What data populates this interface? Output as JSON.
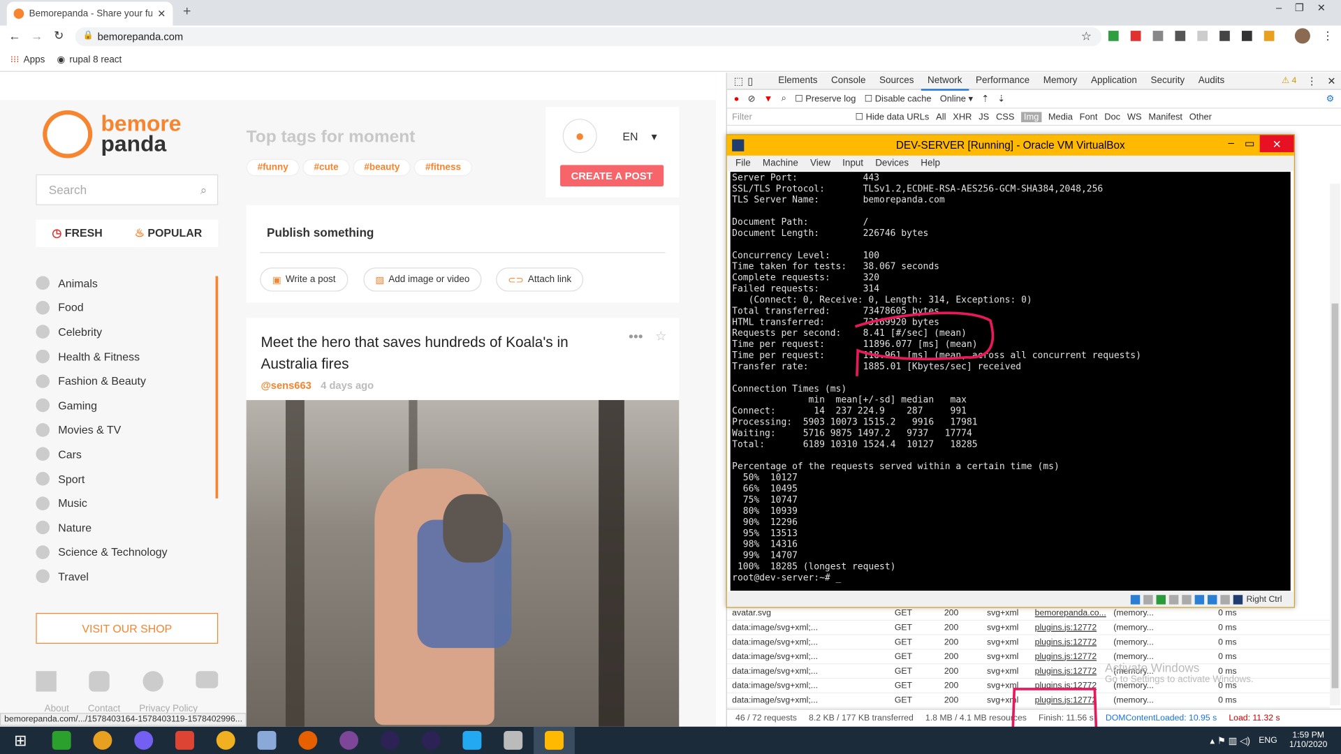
{
  "browser": {
    "tab_title": "Bemorepanda - Share your funny",
    "url": "bemorepanda.com",
    "bookmarks": [
      "Apps",
      "rupal 8 react"
    ],
    "status_url": "bemorepanda.com/.../1578403164-1578403119-1578402996..."
  },
  "site": {
    "logo_line1": "bemore",
    "logo_line2": "panda",
    "search_placeholder": "Search",
    "fresh": "FRESH",
    "popular": "POPULAR",
    "categories": [
      "Animals",
      "Food",
      "Celebrity",
      "Health & Fitness",
      "Fashion & Beauty",
      "Gaming",
      "Movies & TV",
      "Cars",
      "Sport",
      "Music",
      "Nature",
      "Science & Technology",
      "Travel"
    ],
    "visit_shop": "VISIT OUR SHOP",
    "footer_links": [
      "About",
      "Contact",
      "Privacy Policy"
    ],
    "top_tags_title": "Top tags for moment",
    "tags": [
      "#funny",
      "#cute",
      "#beauty",
      "#fitness"
    ],
    "lang": "EN",
    "create_post": "CREATE A POST",
    "publish": "Publish something",
    "actions": [
      "Write a post",
      "Add image or video",
      "Attach link"
    ],
    "post_title": "Meet the hero that saves hundreds of Koala's in Australia fires",
    "post_author": "@sens663",
    "post_time": "4 days ago"
  },
  "devtools": {
    "tabs": [
      "Elements",
      "Console",
      "Sources",
      "Network",
      "Performance",
      "Memory",
      "Application",
      "Security",
      "Audits"
    ],
    "active_tab": "Network",
    "warnings": "4",
    "preserve_log": "Preserve log",
    "disable_cache": "Disable cache",
    "online": "Online",
    "filter_placeholder": "Filter",
    "hide_data_urls": "Hide data URLs",
    "filter_types": [
      "All",
      "XHR",
      "JS",
      "CSS",
      "Img",
      "Media",
      "Font",
      "Doc",
      "WS",
      "Manifest",
      "Other"
    ],
    "active_filter": "Img",
    "rows": [
      {
        "name": "avatar.svg",
        "method": "GET",
        "status": "200",
        "type": "svg+xml",
        "initiator": "bemorepanda.co...",
        "size": "(memory...",
        "time": "0 ms"
      },
      {
        "name": "data:image/svg+xml;...",
        "method": "GET",
        "status": "200",
        "type": "svg+xml",
        "initiator": "plugins.js:12772",
        "size": "(memory...",
        "time": "0 ms"
      },
      {
        "name": "data:image/svg+xml;...",
        "method": "GET",
        "status": "200",
        "type": "svg+xml",
        "initiator": "plugins.js:12772",
        "size": "(memory...",
        "time": "0 ms"
      },
      {
        "name": "data:image/svg+xml;...",
        "method": "GET",
        "status": "200",
        "type": "svg+xml",
        "initiator": "plugins.js:12772",
        "size": "(memory...",
        "time": "0 ms"
      },
      {
        "name": "data:image/svg+xml;...",
        "method": "GET",
        "status": "200",
        "type": "svg+xml",
        "initiator": "plugins.js:12772",
        "size": "(memory...",
        "time": "0 ms"
      },
      {
        "name": "data:image/svg+xml;...",
        "method": "GET",
        "status": "200",
        "type": "svg+xml",
        "initiator": "plugins.js:12772",
        "size": "(memory...",
        "time": "0 ms"
      },
      {
        "name": "data:image/svg+xml;...",
        "method": "GET",
        "status": "200",
        "type": "svg+xml",
        "initiator": "plugins.js:12772",
        "size": "(memory...",
        "time": "0 ms"
      }
    ],
    "status_bar": [
      "46 / 72 requests",
      "8.2 KB / 177 KB transferred",
      "1.8 MB / 4.1 MB resources",
      "Finish: 11.56 s",
      "DOMContentLoaded: 10.95 s",
      "Load: 11.32 s"
    ],
    "watermark1": "Activate Windows",
    "watermark2": "Go to Settings to activate Windows."
  },
  "vm": {
    "title": "DEV-SERVER [Running] - Oracle VM VirtualBox",
    "menu": [
      "File",
      "Machine",
      "View",
      "Input",
      "Devices",
      "Help"
    ],
    "host_key": "Right Ctrl",
    "terminal": [
      "Server Port:            443",
      "SSL/TLS Protocol:       TLSv1.2,ECDHE-RSA-AES256-GCM-SHA384,2048,256",
      "TLS Server Name:        bemorepanda.com",
      "",
      "Document Path:          /",
      "Document Length:        226746 bytes",
      "",
      "Concurrency Level:      100",
      "Time taken for tests:   38.067 seconds",
      "Complete requests:      320",
      "Failed requests:        314",
      "   (Connect: 0, Receive: 0, Length: 314, Exceptions: 0)",
      "Total transferred:      73478605 bytes",
      "HTML transferred:       73169920 bytes",
      "Requests per second:    8.41 [#/sec] (mean)",
      "Time per request:       11896.077 [ms] (mean)",
      "Time per request:       118.961 [ms] (mean, across all concurrent requests)",
      "Transfer rate:          1885.01 [Kbytes/sec] received",
      "",
      "Connection Times (ms)",
      "              min  mean[+/-sd] median   max",
      "Connect:       14  237 224.9    287     991",
      "Processing:  5903 10073 1515.2   9916   17981",
      "Waiting:     5716 9875 1497.2   9737   17774",
      "Total:       6189 10310 1524.4  10127   18285",
      "",
      "Percentage of the requests served within a certain time (ms)",
      "  50%  10127",
      "  66%  10495",
      "  75%  10747",
      "  80%  10939",
      "  90%  12296",
      "  95%  13513",
      "  98%  14316",
      "  99%  14707",
      " 100%  18285 (longest request)",
      "root@dev-server:~# _"
    ]
  },
  "taskbar": {
    "lang": "ENG",
    "time": "1:59 PM",
    "date": "1/10/2020"
  },
  "colors": {
    "accent": "#f7842f",
    "create_btn": "#f7656b",
    "annotation": "#e8185b",
    "vbox_title": "#ffb900"
  }
}
